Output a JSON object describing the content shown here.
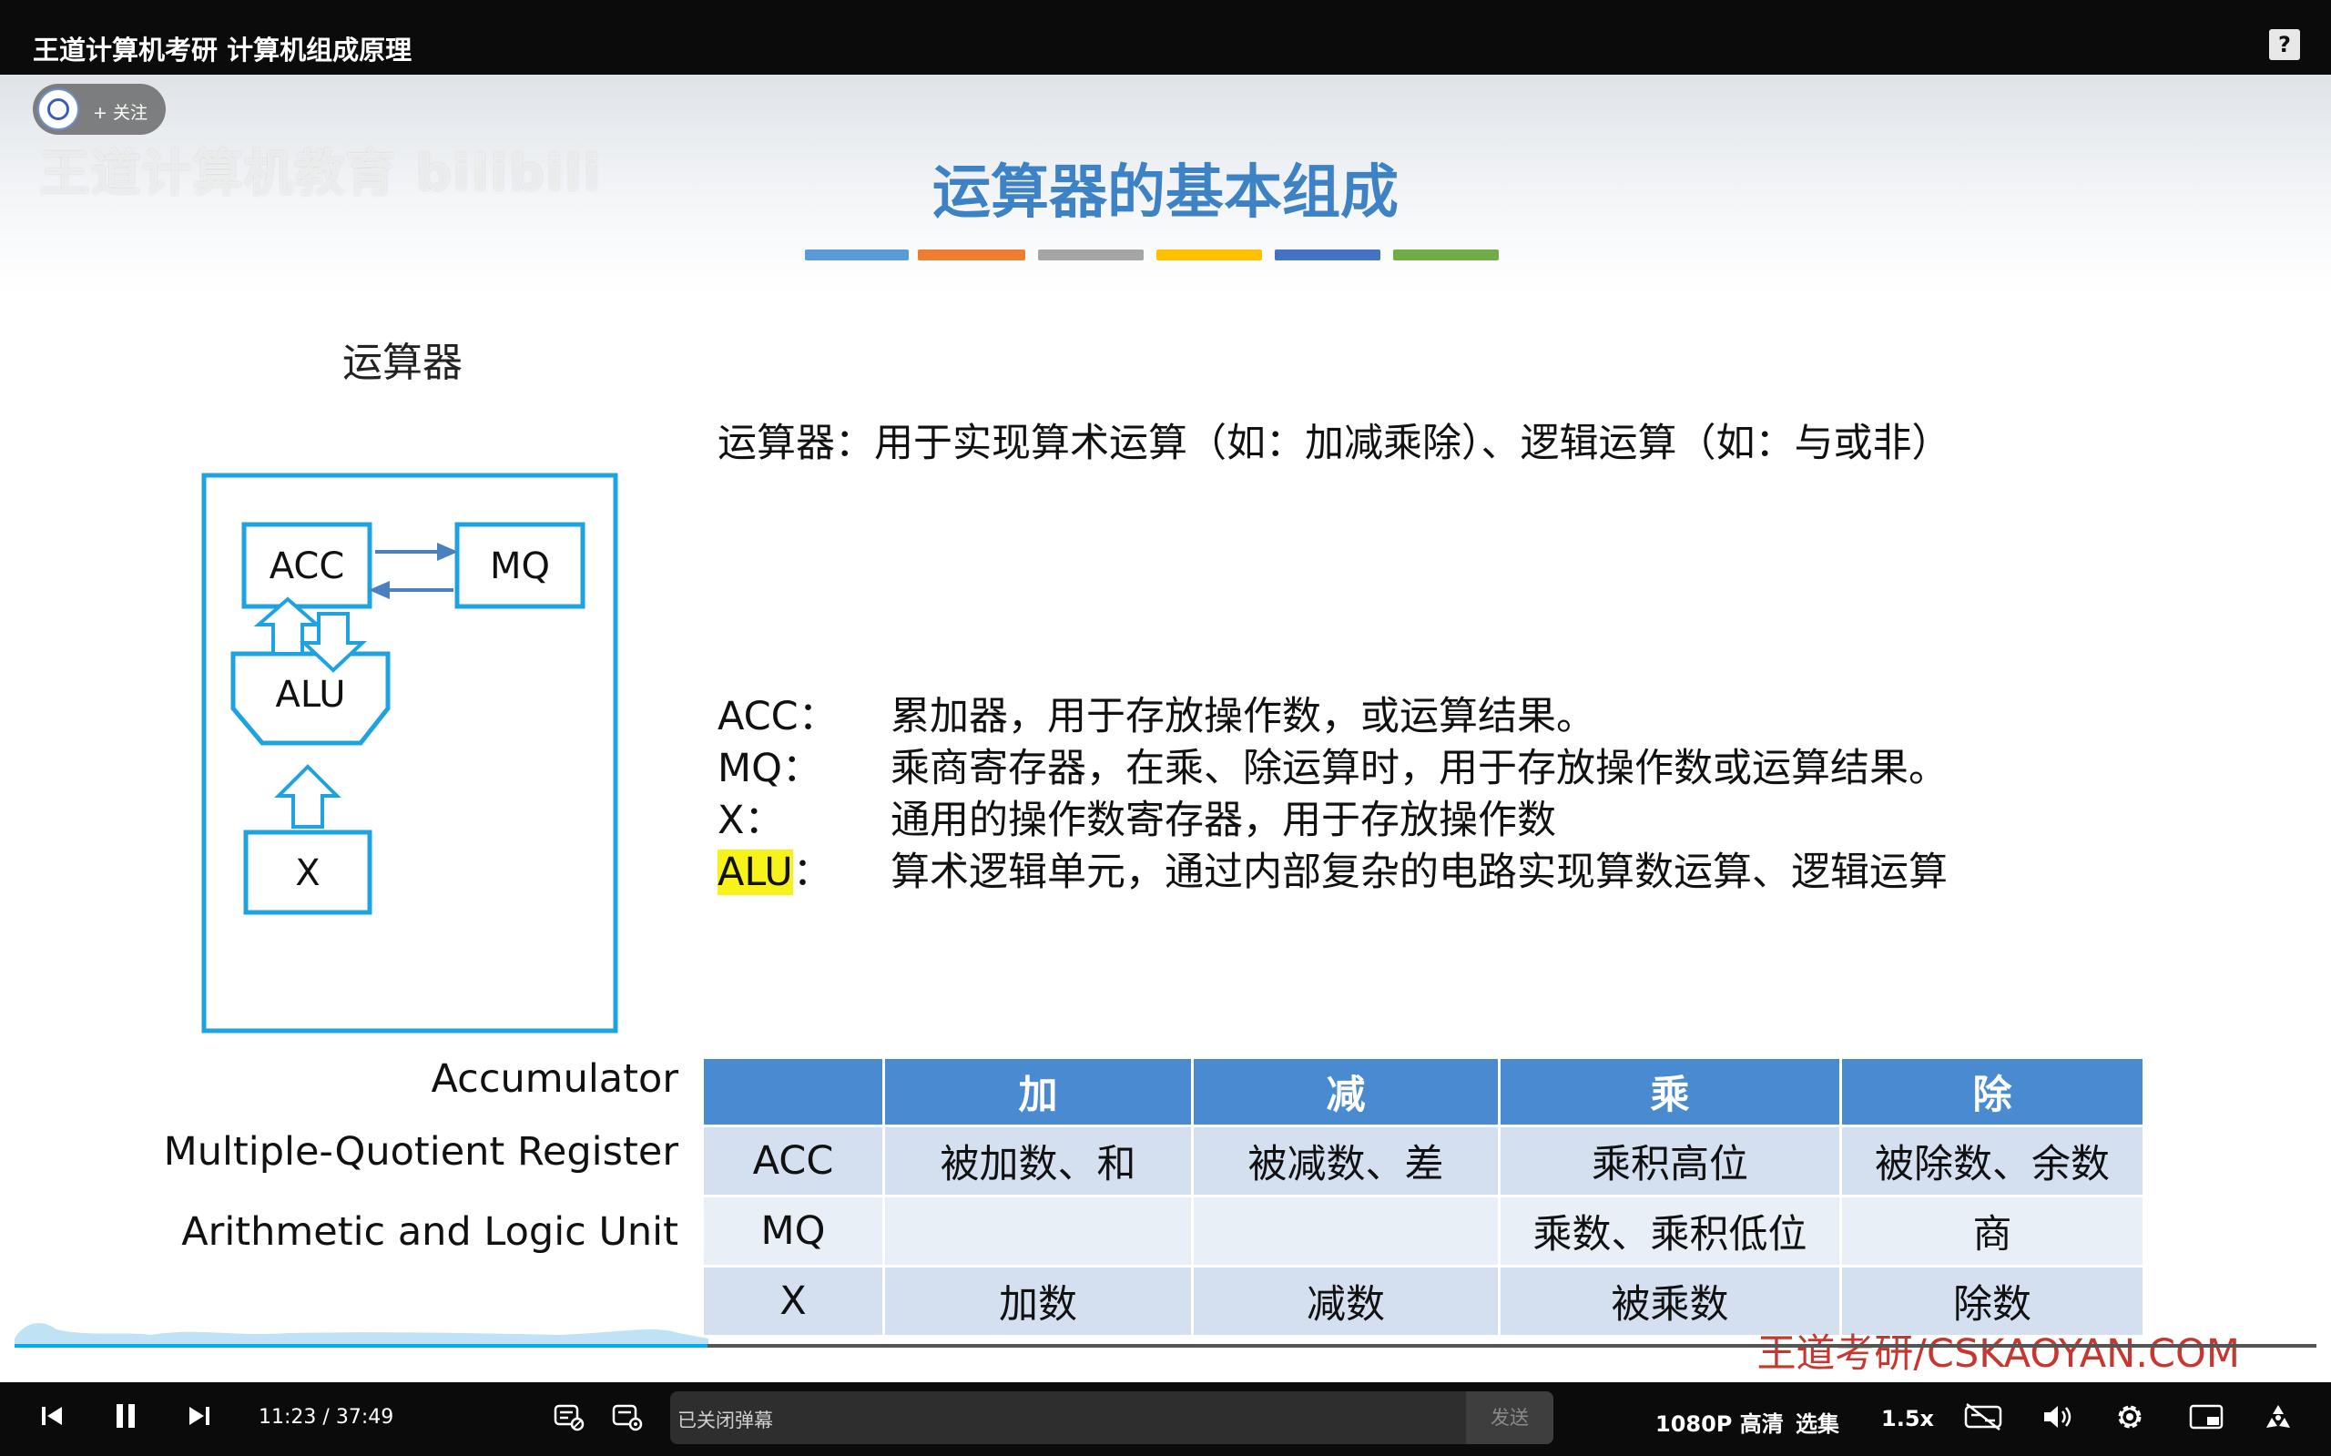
{
  "window": {
    "title": "王道计算机考研 计算机组成原理",
    "help_icon": "?"
  },
  "uploader": {
    "follow_label": "+ 关注",
    "watermark": "王道计算机教育 bilibili"
  },
  "slide": {
    "heading": "运算器的基本组成",
    "colorbar": [
      "#5b9bd5",
      "#ed7d31",
      "#a5a5a5",
      "#ffc000",
      "#4472c4",
      "#70ad47"
    ],
    "diagram_title": "运算器",
    "diagram": {
      "acc": "ACC",
      "mq": "MQ",
      "alu": "ALU",
      "x": "X",
      "color": "#1fa3e0"
    },
    "description": "运算器：用于实现算术运算（如：加减乘除）、逻辑运算（如：与或非）",
    "definitions": [
      {
        "key": "ACC：",
        "text": "累加器，用于存放操作数，或运算结果。"
      },
      {
        "key": "MQ：",
        "text": "乘商寄存器，在乘、除运算时，用于存放操作数或运算结果。"
      },
      {
        "key": "X：",
        "text": "通用的操作数寄存器，用于存放操作数"
      },
      {
        "key_hl": "ALU",
        "key_rest": "：",
        "text": "算术逻辑单元，通过内部复杂的电路实现算数运算、逻辑运算"
      }
    ],
    "row_labels": [
      "Accumulator",
      "Multiple-Quotient Register",
      "Arithmetic and Logic Unit"
    ],
    "table": {
      "headers": [
        "",
        "加",
        "减",
        "乘",
        "除"
      ],
      "rows": [
        [
          "ACC",
          "被加数、和",
          "被减数、差",
          "乘积高位",
          "被除数、余数"
        ],
        [
          "MQ",
          "",
          "",
          "乘数、乘积低位",
          "商"
        ],
        [
          "X",
          "加数",
          "减数",
          "被乘数",
          "除数"
        ]
      ]
    },
    "brand": "王道考研/CSKAOYAN.COM"
  },
  "player": {
    "current_time": "11:23",
    "separator": "/",
    "duration": "37:49",
    "danmaku_placeholder": "已关闭弹幕",
    "send_label": "发送",
    "quality": "1080P 高清",
    "episodes": "选集",
    "speed": "1.5x",
    "progress_fraction": 0.301
  }
}
